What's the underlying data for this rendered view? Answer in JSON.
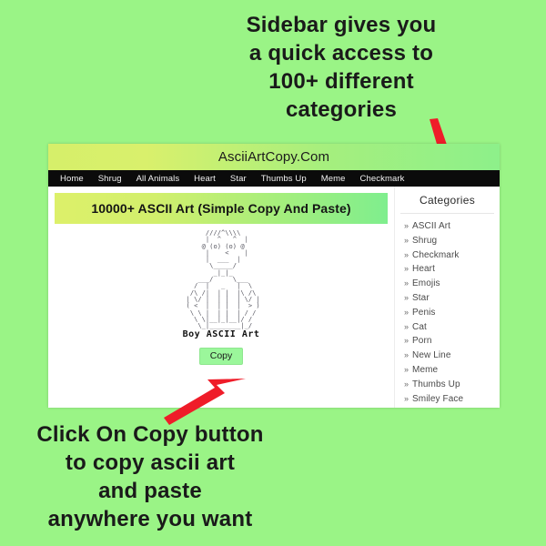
{
  "background_color": "#9af486",
  "annotation": {
    "top_caption_lines": [
      "Sidebar gives you",
      "a quick access to",
      "100+ different",
      "categories"
    ],
    "bottom_caption_lines": [
      "Click On Copy button",
      "to copy ascii art",
      "and paste",
      "anywhere you want"
    ],
    "arrow_color": "#ef1c29"
  },
  "site": {
    "title": "AsciiArtCopy.Com",
    "nav_items": [
      "Home",
      "Shrug",
      "All Animals",
      "Heart",
      "Star",
      "Thumbs Up",
      "Meme",
      "Checkmark"
    ],
    "page_heading": "10000+ ASCII Art (Simple Copy And Paste)",
    "art": {
      "ascii": "      ////^\\\\\\\\\n      |  ^   ^  |\n     @ (o) (o) @\n      |    <    |\n      |  ___  |\n       \\_____/\n        _|_|_\n    ___/     \\___\n   /  |   _   |  \\\n  /\\ /|  | |  |\\ /\\\n | \\/ |  | |  | \\/ |\n ( <  |  | |  |  > )\n  \\ \\ |  | |  | / /\n   \\ \\|__|_|__|/ /\n    \\_|________|_/",
      "label": "Boy ASCII Art",
      "copy_button": "Copy"
    },
    "sidebar": {
      "title": "Categories",
      "bullet": "»",
      "items": [
        "ASCII Art",
        "Shrug",
        "Checkmark",
        "Heart",
        "Emojis",
        "Star",
        "Penis",
        "Cat",
        "Porn",
        "New Line",
        "Meme",
        "Thumbs Up",
        "Smiley Face"
      ]
    }
  }
}
